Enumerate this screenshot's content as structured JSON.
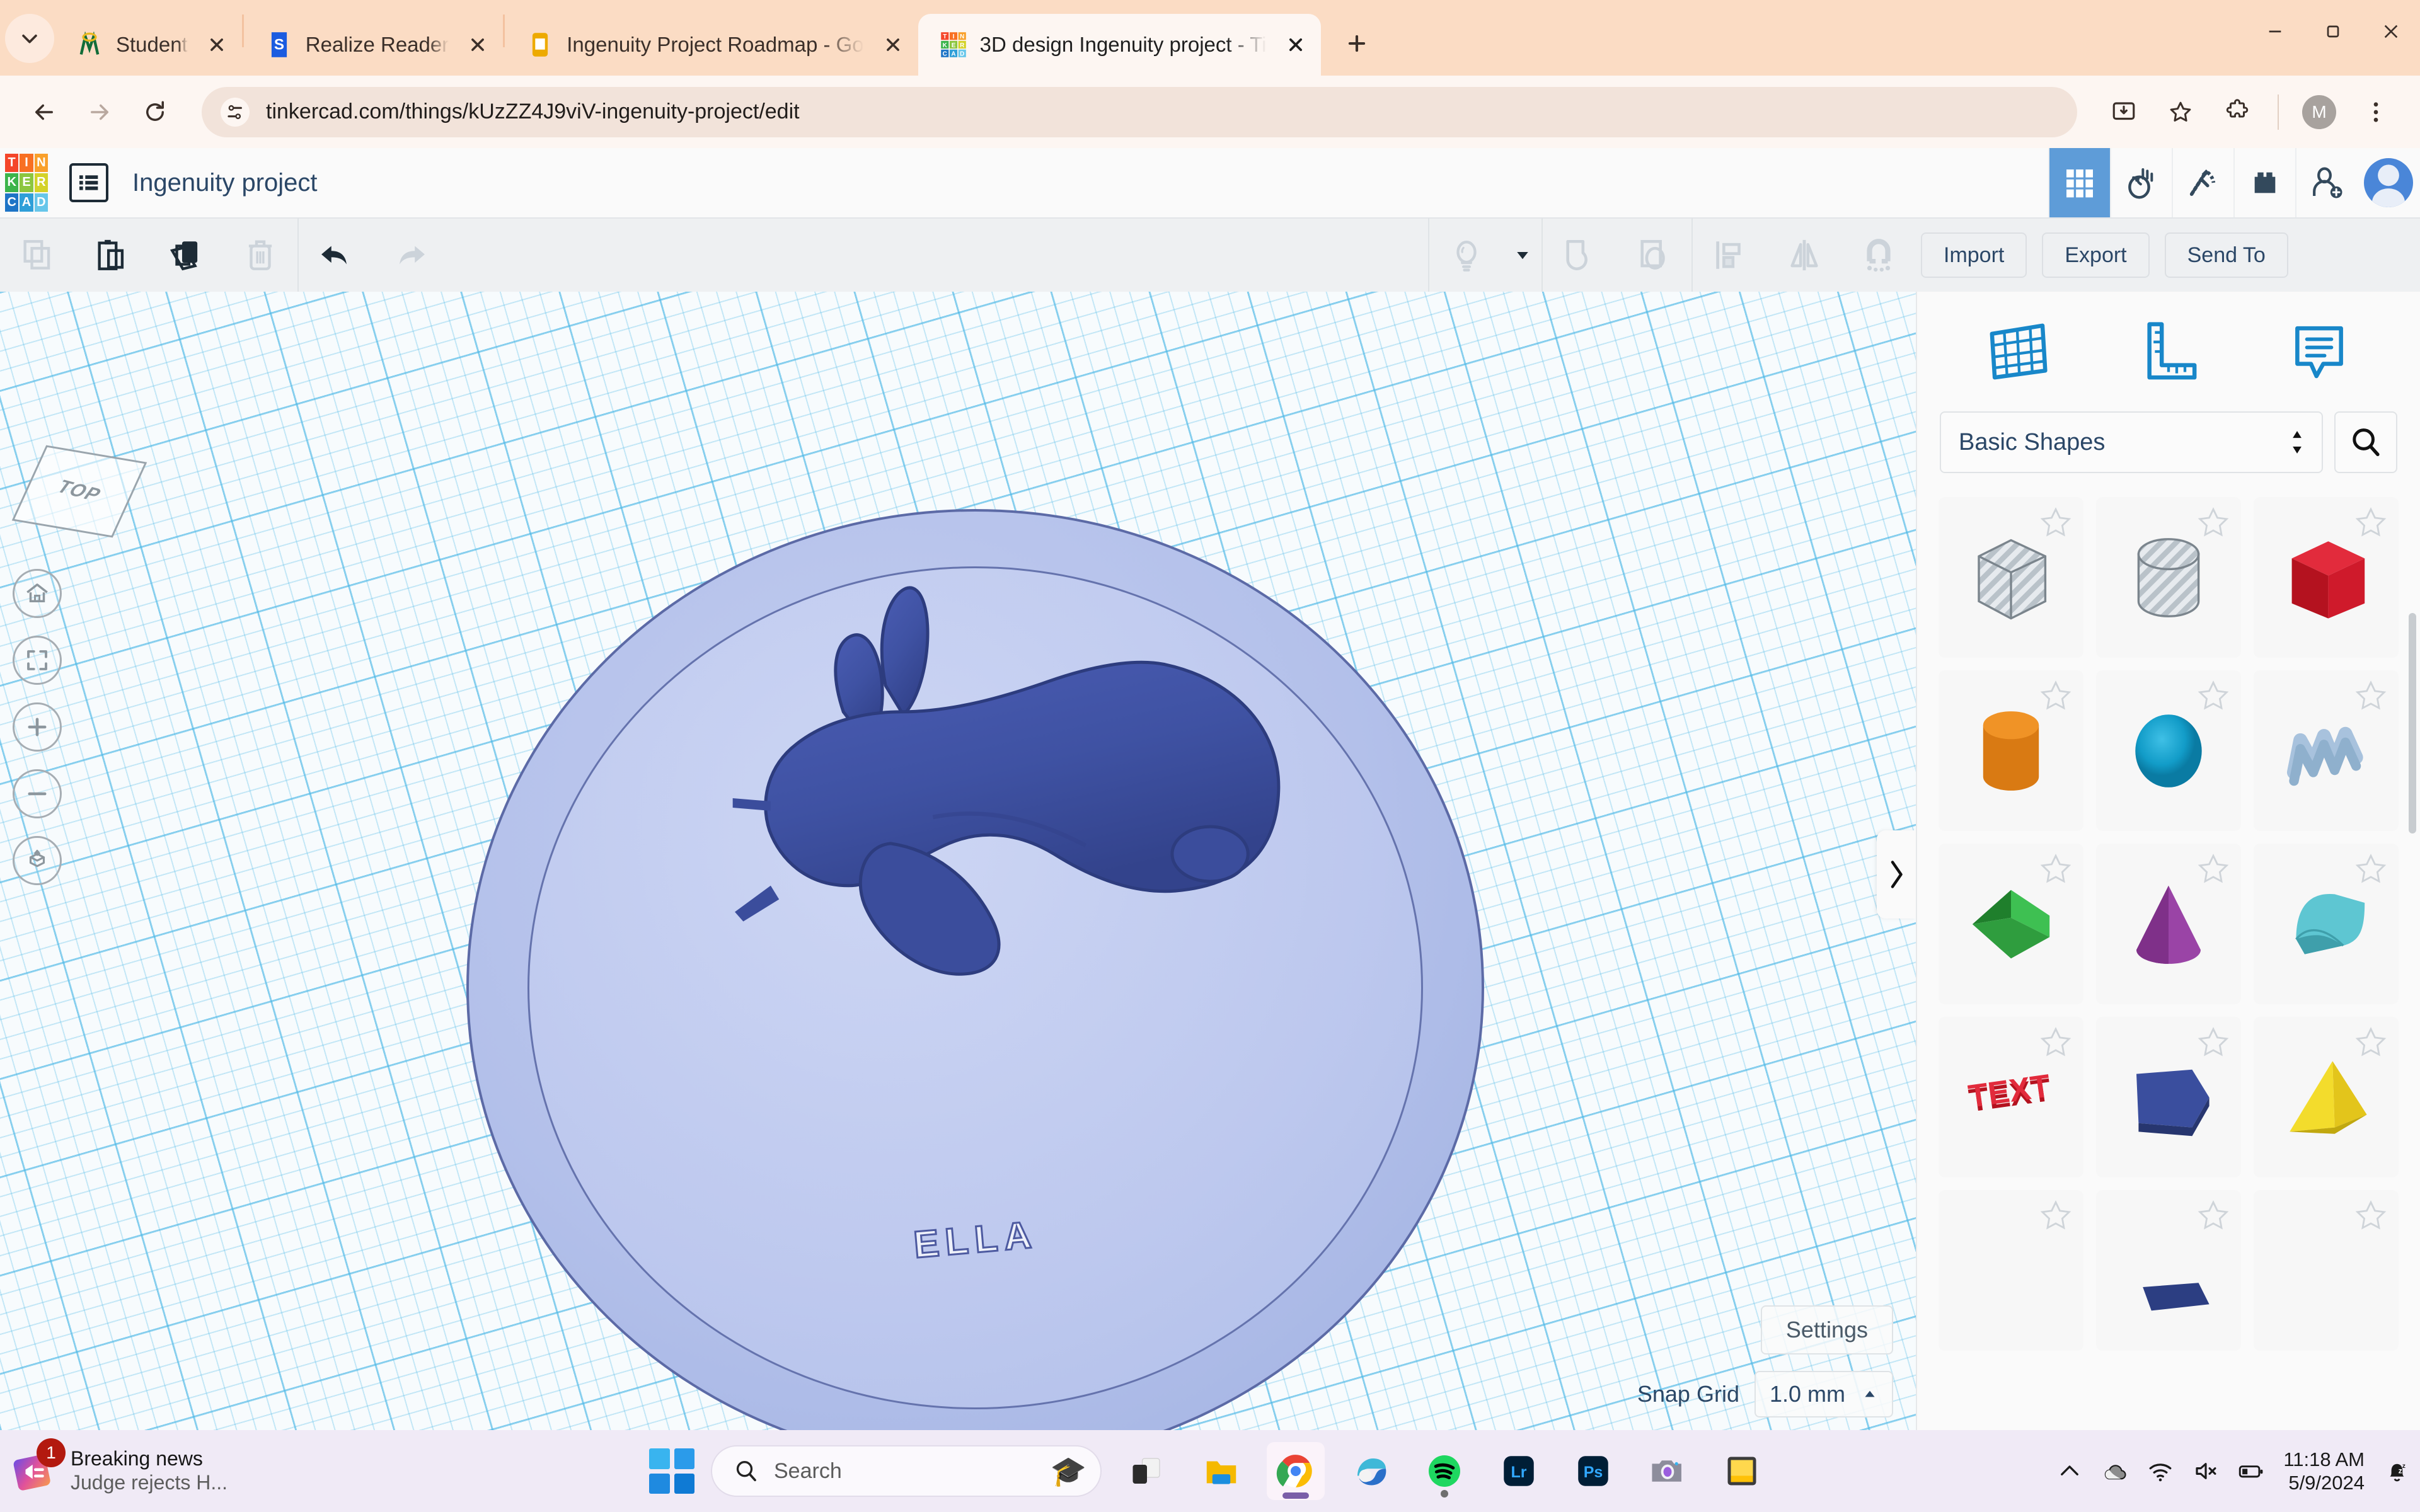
{
  "browser": {
    "tabs": [
      {
        "title": "Student",
        "favicon": "mcgraw-hill-icon",
        "active": false
      },
      {
        "title": "Realize Reader",
        "favicon": "savvas-realize-icon",
        "active": false
      },
      {
        "title": "Ingenuity Project Roadmap - Go",
        "favicon": "google-docs-icon",
        "active": false
      },
      {
        "title": "3D design Ingenuity project - Ti",
        "favicon": "tinkercad-icon",
        "active": true
      }
    ],
    "new_tab_label": "+",
    "window_controls": {
      "minimize": "minimize-icon",
      "maximize": "maximize-icon",
      "close": "close-icon"
    },
    "nav": {
      "back": "back-arrow-icon",
      "forward": "forward-arrow-icon",
      "reload": "reload-icon",
      "url": "tinkercad.com/things/kUzZZ4J9viV-ingenuity-project/edit",
      "url_domain": "tinkercad.com",
      "url_path": "/things/kUzZZ4J9viV-ingenuity-project/edit",
      "install_icon": "install-app-icon",
      "bookmark_icon": "star-icon",
      "extensions_icon": "extensions-puzzle-icon",
      "profile_initial": "M",
      "menu_icon": "three-dot-menu-icon"
    }
  },
  "tinkercad": {
    "logo_cells": [
      {
        "letter": "T",
        "color": "#f4462a"
      },
      {
        "letter": "I",
        "color": "#f87023"
      },
      {
        "letter": "N",
        "color": "#f9a02b"
      },
      {
        "letter": "K",
        "color": "#3cb44b"
      },
      {
        "letter": "E",
        "color": "#8cc63f"
      },
      {
        "letter": "R",
        "color": "#d4d229"
      },
      {
        "letter": "C",
        "color": "#1e74c6"
      },
      {
        "letter": "A",
        "color": "#2f9fd8"
      },
      {
        "letter": "D",
        "color": "#67c6ea"
      }
    ],
    "project_title": "Ingenuity project",
    "mode_buttons": [
      {
        "name": "3d-design-mode",
        "icon": "grid-icon",
        "active": true
      },
      {
        "name": "circuits-mode",
        "icon": "hand-heart-icon",
        "active": false
      },
      {
        "name": "codeblocks-mode",
        "icon": "pickaxe-icon",
        "active": false
      },
      {
        "name": "blocks-mode",
        "icon": "brick-icon",
        "active": false
      },
      {
        "name": "invite-people",
        "icon": "add-person-icon",
        "active": false
      }
    ],
    "toolbar": {
      "copy": "copy-icon",
      "paste": "paste-icon",
      "duplicate": "duplicate-icon",
      "delete": "trash-icon",
      "undo": "undo-arrow-icon",
      "redo": "redo-arrow-icon",
      "light": "lightbulb-icon",
      "light_dropdown": "chevron-down-icon",
      "group": "group-shapes-icon",
      "ungroup": "ungroup-shapes-icon",
      "align": "align-icon",
      "mirror": "mirror-flip-icon",
      "snap": "magnet-icon"
    },
    "actions": {
      "import": "Import",
      "export": "Export",
      "send_to": "Send To"
    },
    "viewport": {
      "view_cube_label": "TOP",
      "nav_buttons": [
        {
          "name": "home-view-button",
          "icon": "home-icon"
        },
        {
          "name": "fit-to-view-button",
          "icon": "fit-frame-icon"
        },
        {
          "name": "zoom-in-button",
          "icon": "plus-icon"
        },
        {
          "name": "zoom-out-button",
          "icon": "minus-icon"
        },
        {
          "name": "ortho-perspective-toggle",
          "icon": "cube-arrow-icon"
        }
      ],
      "model_text": "ELLA",
      "model_color": "#3f52a3",
      "base_color": "#b9c5ec",
      "settings_label": "Settings",
      "snap_grid_label": "Snap Grid",
      "snap_grid_value": "1.0 mm",
      "snap_grid_caret": "caret-up-icon"
    },
    "panel": {
      "collapse_handle": "chevron-right-icon",
      "tabs": [
        {
          "name": "workplane-tab",
          "icon": "workplane-grid-icon"
        },
        {
          "name": "ruler-tab",
          "icon": "ruler-icon"
        },
        {
          "name": "notes-tab",
          "icon": "note-callout-icon"
        }
      ],
      "category": "Basic Shapes",
      "category_caret": "updown-caret-icon",
      "search_icon": "search-icon",
      "shapes": [
        {
          "name": "box-hole",
          "color": "#d6dade",
          "kind": "hole-box"
        },
        {
          "name": "cylinder-hole",
          "color": "#d6dade",
          "kind": "hole-cylinder"
        },
        {
          "name": "box",
          "color": "#cf1a2b",
          "kind": "box"
        },
        {
          "name": "cylinder",
          "color": "#e8861f",
          "kind": "cylinder"
        },
        {
          "name": "sphere",
          "color": "#129cc8",
          "kind": "sphere"
        },
        {
          "name": "scribble",
          "color": "#a8c2dd",
          "kind": "scribble"
        },
        {
          "name": "wedge",
          "color": "#2f9d3e",
          "kind": "wedge"
        },
        {
          "name": "cone",
          "color": "#8e3a98",
          "kind": "cone"
        },
        {
          "name": "roof",
          "color": "#4fb3bf",
          "kind": "roof"
        },
        {
          "name": "text",
          "color": "#cf1a2b",
          "kind": "text",
          "label": "TEXT"
        },
        {
          "name": "polygon",
          "color": "#2c3e82",
          "kind": "polygon"
        },
        {
          "name": "pyramid",
          "color": "#e3c51b",
          "kind": "pyramid"
        }
      ]
    }
  },
  "taskbar": {
    "news": {
      "badge": "1",
      "title": "Breaking news",
      "subtitle": "Judge rejects H...",
      "icon": "news-icon"
    },
    "start_icon": "windows-start-icon",
    "search_placeholder": "Search",
    "search_icon": "search-icon",
    "search_decoration": "graduation-cap-icon",
    "apps": [
      {
        "name": "task-view",
        "icon": "task-view-icon",
        "active": false
      },
      {
        "name": "file-explorer",
        "icon": "folder-icon",
        "active": false
      },
      {
        "name": "google-chrome",
        "icon": "chrome-icon",
        "active": true
      },
      {
        "name": "microsoft-edge",
        "icon": "edge-icon",
        "active": false
      },
      {
        "name": "spotify",
        "icon": "spotify-icon",
        "active": false,
        "running": true
      },
      {
        "name": "adobe-lightroom",
        "icon": "lightroom-icon",
        "label": "Lr",
        "active": false
      },
      {
        "name": "adobe-photoshop",
        "icon": "photoshop-icon",
        "label": "Ps",
        "active": false
      },
      {
        "name": "camera",
        "icon": "camera-icon",
        "active": false
      },
      {
        "name": "sticky-notes",
        "icon": "sticky-note-icon",
        "active": false
      }
    ],
    "tray": {
      "overflow": "chevron-up-icon",
      "onedrive": "onedrive-cloud-icon",
      "wifi": "wifi-icon",
      "volume": "volume-muted-icon",
      "battery": "battery-icon",
      "time": "11:18 AM",
      "date": "5/9/2024",
      "notifications": "notifications-snooze-icon"
    }
  }
}
